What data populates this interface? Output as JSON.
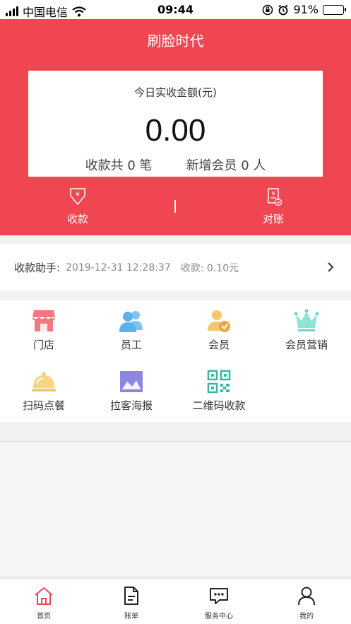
{
  "status_bar": {
    "carrier": "中国电信",
    "time": "09:44",
    "battery": "91%"
  },
  "header": {
    "title": "刷脸时代"
  },
  "summary": {
    "label": "今日实收金额(元)",
    "amount": "0.00",
    "payments": "收款共 0 笔",
    "new_members": "新增会员 0 人"
  },
  "actions": [
    {
      "label": "收款"
    },
    {
      "label": "对账"
    }
  ],
  "helper": {
    "label": "收款助手:",
    "time": "2019-12-31 12:28:37",
    "amount": "收款: 0.10元"
  },
  "features": [
    {
      "label": "门店",
      "icon": "store-icon"
    },
    {
      "label": "员工",
      "icon": "staff-icon"
    },
    {
      "label": "会员",
      "icon": "member-icon"
    },
    {
      "label": "会员营销",
      "icon": "crown-icon"
    },
    {
      "label": "扫码点餐",
      "icon": "dish-cover-icon"
    },
    {
      "label": "拉客海报",
      "icon": "poster-icon"
    },
    {
      "label": "二维码收款",
      "icon": "qr-code-icon"
    }
  ],
  "tabs": [
    {
      "label": "首页",
      "icon": "home-icon",
      "active": true
    },
    {
      "label": "账单",
      "icon": "bill-icon"
    },
    {
      "label": "服务中心",
      "icon": "chat-icon"
    },
    {
      "label": "我的",
      "icon": "user-icon"
    }
  ],
  "colors": {
    "brand": "#f04652",
    "battery": "#4cd964",
    "member_gold": "#f5c66b",
    "qr_teal": "#3bb5a4"
  }
}
